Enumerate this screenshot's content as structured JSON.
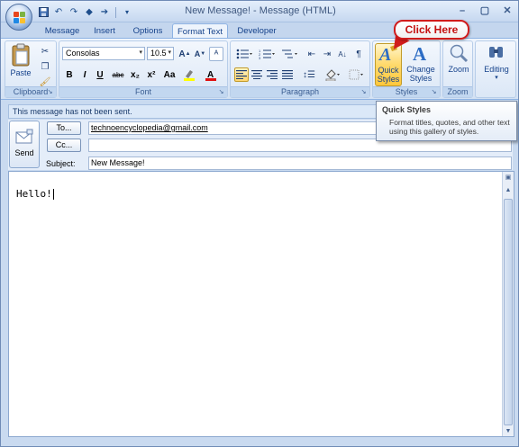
{
  "window": {
    "title": "New Message! - Message (HTML)"
  },
  "qat": {
    "items": [
      "save-icon",
      "undo-icon",
      "redo-icon",
      "up-arrow-icon",
      "down-arrow-icon",
      "customize-icon"
    ]
  },
  "tabs": [
    {
      "label": "Message",
      "active": false
    },
    {
      "label": "Insert",
      "active": false
    },
    {
      "label": "Options",
      "active": false
    },
    {
      "label": "Format Text",
      "active": true
    },
    {
      "label": "Developer",
      "active": false
    }
  ],
  "ribbon": {
    "clipboard": {
      "label": "Clipboard",
      "paste_label": "Paste"
    },
    "font": {
      "label": "Font",
      "font_name": "Consolas",
      "font_size": "10.5",
      "bold": "B",
      "italic": "I",
      "underline": "U",
      "strike": "abc",
      "subscript": "x₂",
      "superscript": "x²",
      "change_case": "Aa"
    },
    "paragraph": {
      "label": "Paragraph"
    },
    "styles": {
      "label": "Styles",
      "quick_styles_label_1": "Quick",
      "quick_styles_label_2": "Styles",
      "change_styles_label_1": "Change",
      "change_styles_label_2": "Styles"
    },
    "zoom": {
      "label": "Zoom",
      "zoom_label": "Zoom"
    },
    "editing": {
      "label": "Editing"
    }
  },
  "callout": {
    "text": "Click Here"
  },
  "infobar": {
    "text": "This message has not been sent."
  },
  "header": {
    "send_label": "Send",
    "to_button": "To...",
    "cc_button": "Cc...",
    "subject_label": "Subject:",
    "to_value": "technoencyclopedia@gmail.com",
    "cc_value": "",
    "subject_value": "New Message!"
  },
  "body": {
    "text": "Hello!"
  },
  "tooltip": {
    "title": "Quick Styles",
    "description": "Format titles, quotes, and other text using this gallery of styles."
  },
  "colors": {
    "accent": "#15428b",
    "callout_red": "#d01c1c",
    "highlight_yellow": "#ffd96b",
    "ribbon_bg": "#dfe9f7"
  }
}
